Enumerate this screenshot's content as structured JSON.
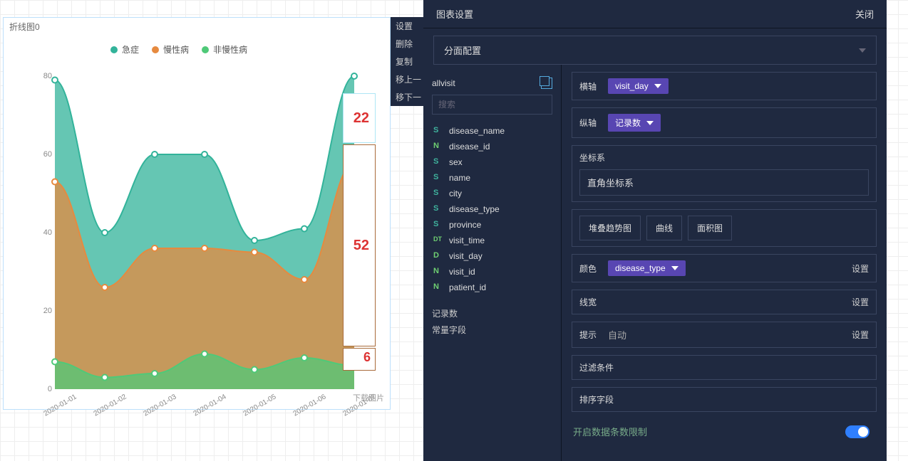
{
  "chart": {
    "title": "折线图0",
    "download_label": "下载图片",
    "legend": [
      {
        "name": "急症",
        "color": "#32b39a"
      },
      {
        "name": "慢性病",
        "color": "#e68a3f"
      },
      {
        "name": "非慢性病",
        "color": "#4fc978"
      }
    ],
    "y_ticks": [
      "0",
      "20",
      "40",
      "60",
      "80"
    ],
    "annotations": [
      {
        "value": "22",
        "color": "#4fbfe6"
      },
      {
        "value": "52",
        "color": "#a96b3a"
      },
      {
        "value": "6",
        "color": "#a96b3a"
      }
    ]
  },
  "chart_data": {
    "type": "area",
    "stacked": true,
    "title": "折线图0",
    "xlabel": "",
    "ylabel": "",
    "ylim": [
      0,
      80
    ],
    "categories": [
      "2020-01-01",
      "2020-01-02",
      "2020-01-03",
      "2020-01-04",
      "2020-01-05",
      "2020-01-06",
      "2020-01-07"
    ],
    "series": [
      {
        "name": "急症",
        "color": "#32b39a",
        "values": [
          79,
          40,
          60,
          60,
          38,
          41,
          80
        ]
      },
      {
        "name": "慢性病",
        "color": "#e68a3f",
        "values": [
          53,
          26,
          36,
          36,
          35,
          28,
          58
        ]
      },
      {
        "name": "非慢性病",
        "color": "#4fc978",
        "values": [
          7,
          3,
          4,
          9,
          5,
          8,
          6
        ]
      }
    ],
    "last_point_breakdown": {
      "急症": 22,
      "慢性病": 52,
      "非慢性病": 6
    }
  },
  "context_menu": {
    "items": [
      "设置",
      "删除",
      "复制",
      "移上一",
      "移下一"
    ]
  },
  "settings": {
    "title": "图表设置",
    "close": "关闭",
    "facet_label": "分面配置",
    "dataset_name": "allvisit",
    "search_placeholder": "搜索",
    "fields": [
      {
        "type": "S",
        "name": "disease_name"
      },
      {
        "type": "N",
        "name": "disease_id"
      },
      {
        "type": "S",
        "name": "sex"
      },
      {
        "type": "S",
        "name": "name"
      },
      {
        "type": "S",
        "name": "city"
      },
      {
        "type": "S",
        "name": "disease_type"
      },
      {
        "type": "S",
        "name": "province"
      },
      {
        "type": "DT",
        "name": "visit_time"
      },
      {
        "type": "D",
        "name": "visit_day"
      },
      {
        "type": "N",
        "name": "visit_id"
      },
      {
        "type": "N",
        "name": "patient_id"
      }
    ],
    "extra_fields": [
      "记录数",
      "常量字段"
    ],
    "config": {
      "x_label": "横轴",
      "x_value": "visit_day",
      "y_label": "纵轴",
      "y_value": "记录数",
      "coord_label": "坐标系",
      "coord_value": "直角坐标系",
      "chart_types": [
        "堆叠趋势图",
        "曲线",
        "面积图"
      ],
      "color_label": "颜色",
      "color_value": "disease_type",
      "set_label": "设置",
      "line_width_label": "线宽",
      "tooltip_label": "提示",
      "tooltip_value": "自动",
      "filter_label": "过滤条件",
      "sort_label": "排序字段",
      "row_limit_label": "开启数据条数限制"
    }
  }
}
